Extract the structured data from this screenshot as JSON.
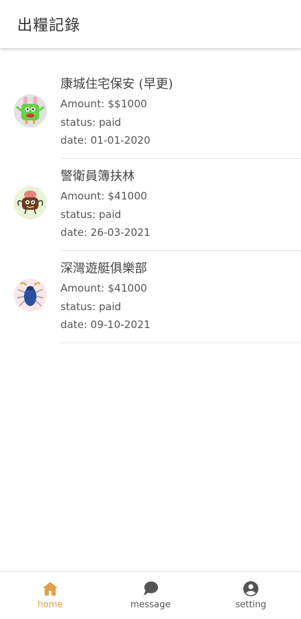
{
  "header": {
    "title": "出糧記錄"
  },
  "records": [
    {
      "title": "康城住宅保安 (早更)",
      "amount": "Amount: $$1000",
      "status": "status: paid",
      "date": "date: 01-01-2020",
      "avatar_icon": "green-monster-avatar"
    },
    {
      "title": "警衛員簿扶林",
      "amount": "Amount: $41000",
      "status": "status: paid",
      "date": "date: 26-03-2021",
      "avatar_icon": "brown-monster-avatar"
    },
    {
      "title": "深灣遊艇俱樂部",
      "amount": "Amount: $41000",
      "status": "status: paid",
      "date": "date: 09-10-2021",
      "avatar_icon": "blue-beetle-avatar"
    }
  ],
  "bottom_nav": {
    "items": [
      {
        "label": "home",
        "icon": "home-icon",
        "active": true
      },
      {
        "label": "message",
        "icon": "chat-bubble-icon",
        "active": false
      },
      {
        "label": "setting",
        "icon": "account-circle-icon",
        "active": false
      }
    ]
  },
  "colors": {
    "accent": "#e0a04a",
    "inactive": "#555555"
  }
}
